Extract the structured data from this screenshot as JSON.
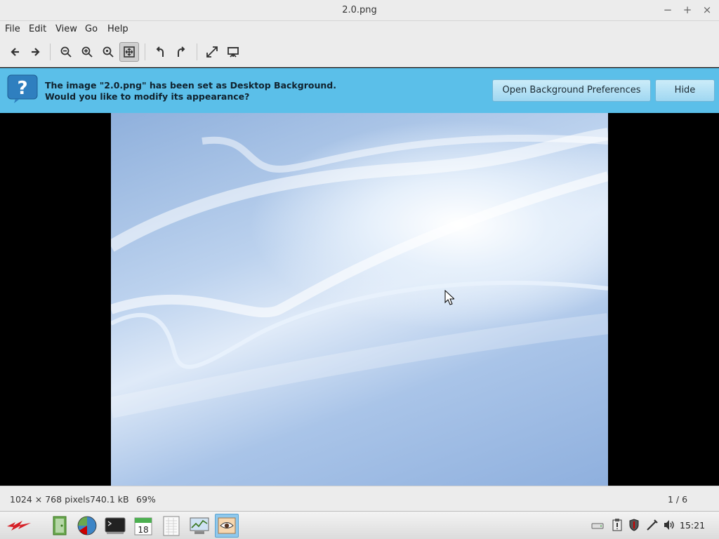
{
  "window": {
    "title": "2.0.png",
    "minimize_label": "−",
    "maximize_label": "+",
    "close_label": "×"
  },
  "menubar": {
    "items": [
      "File",
      "Edit",
      "View",
      "Go",
      "Help"
    ]
  },
  "toolbar": {
    "buttons": [
      {
        "icon": "back-icon"
      },
      {
        "icon": "forward-icon"
      },
      {
        "icon": "zoom-out-icon"
      },
      {
        "icon": "zoom-in-icon"
      },
      {
        "icon": "zoom-normal-icon"
      },
      {
        "icon": "zoom-fit-icon",
        "active": true
      },
      {
        "icon": "rotate-left-icon"
      },
      {
        "icon": "rotate-right-icon"
      },
      {
        "icon": "fullscreen-icon"
      },
      {
        "icon": "slideshow-icon"
      }
    ]
  },
  "infobar": {
    "icon": "question-icon",
    "line1": "The image \"2.0.png\" has been set as Desktop Background.",
    "line2": "Would you like to modify its appearance?",
    "open_prefs_label": "Open Background Preferences",
    "hide_label": "Hide",
    "color": "#5bbfe9"
  },
  "statusbar": {
    "dimensions": "1024 × 768 pixels",
    "filesize": "740.1 kB",
    "zoom": "69%",
    "position": "1 / 6"
  },
  "taskbar": {
    "apps": [
      {
        "icon": "menu-logo-icon"
      },
      {
        "icon": "file-manager-icon"
      },
      {
        "icon": "web-browser-icon"
      },
      {
        "icon": "terminal-icon"
      },
      {
        "icon": "calendar-icon",
        "text": "18"
      },
      {
        "icon": "text-editor-icon"
      },
      {
        "icon": "system-monitor-icon"
      },
      {
        "icon": "image-viewer-icon",
        "active": true
      }
    ],
    "tray": [
      "drive-icon",
      "clipboard-icon",
      "shield-icon",
      "network-icon",
      "volume-icon"
    ],
    "clock": "15:21"
  }
}
